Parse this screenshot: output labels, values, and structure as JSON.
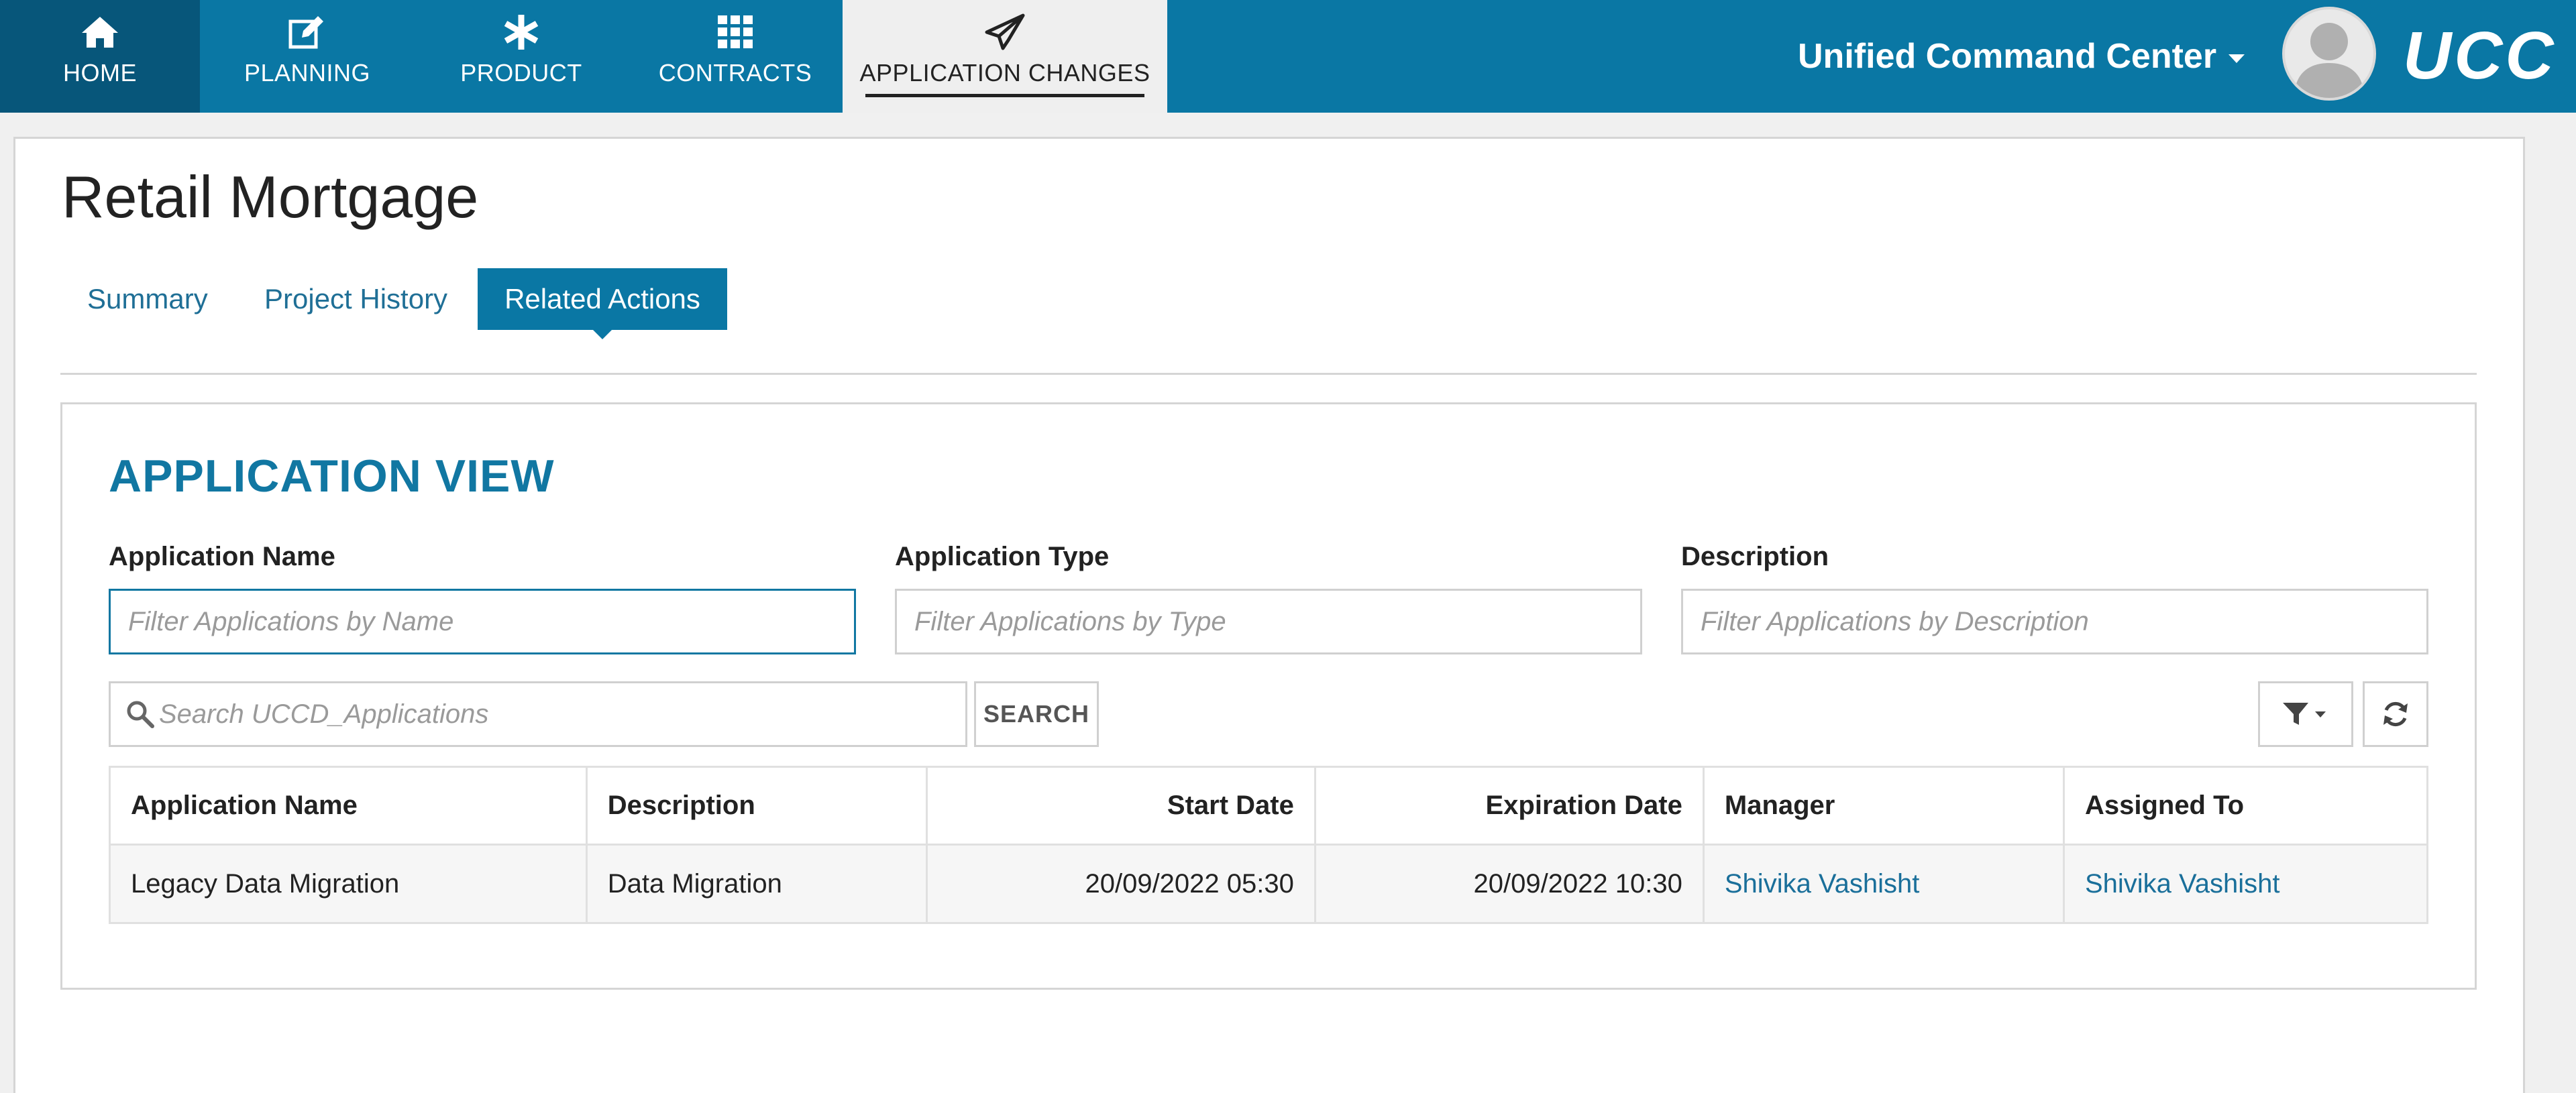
{
  "nav": {
    "tabs": [
      {
        "label": "HOME",
        "icon": "home-icon"
      },
      {
        "label": "PLANNING",
        "icon": "edit-icon"
      },
      {
        "label": "PRODUCT",
        "icon": "asterisk-icon"
      },
      {
        "label": "CONTRACTS",
        "icon": "grid-icon"
      },
      {
        "label": "APPLICATION CHANGES",
        "icon": "paper-plane-icon",
        "active": true
      }
    ],
    "app_title": "Unified Command Center",
    "brand": "UCC"
  },
  "page": {
    "title": "Retail Mortgage",
    "subtabs": [
      {
        "label": "Summary"
      },
      {
        "label": "Project History"
      },
      {
        "label": "Related Actions",
        "active": true
      }
    ]
  },
  "view": {
    "title": "APPLICATION VIEW",
    "filters": {
      "name_label": "Application Name",
      "name_placeholder": "Filter Applications by Name",
      "type_label": "Application Type",
      "type_placeholder": "Filter Applications by Type",
      "desc_label": "Description",
      "desc_placeholder": "Filter Applications by Description"
    },
    "search": {
      "placeholder": "Search UCCD_Applications",
      "button": "SEARCH"
    },
    "table": {
      "headers": [
        "Application Name",
        "Description",
        "Start Date",
        "Expiration Date",
        "Manager",
        "Assigned To"
      ],
      "rows": [
        [
          "Legacy Data Migration",
          "Data Migration",
          "20/09/2022 05:30",
          "20/09/2022 10:30",
          "Shivika Vashisht",
          "Shivika Vashisht"
        ]
      ]
    }
  },
  "colors": {
    "primary": "#0a77a4",
    "primary_dark": "#07567a",
    "heading": "#1177a2",
    "link": "#1a6f9a"
  }
}
